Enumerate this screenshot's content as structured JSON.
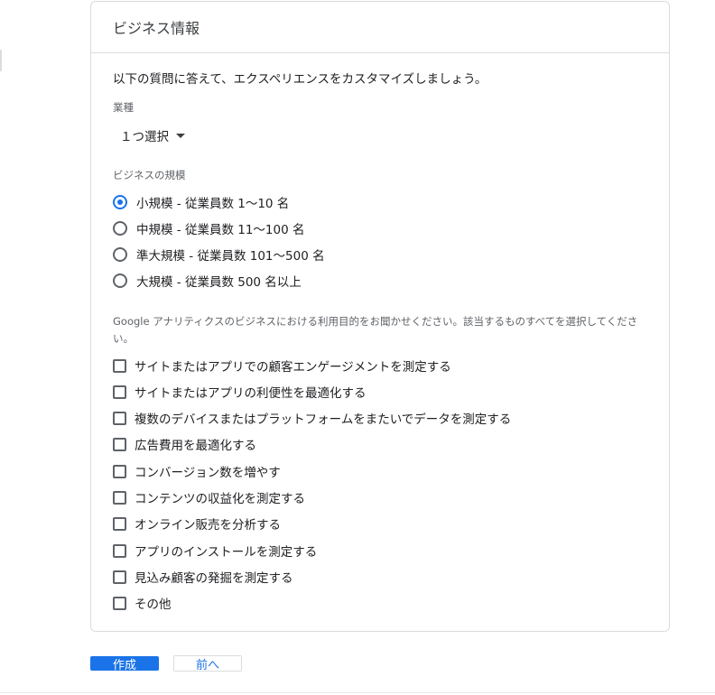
{
  "card": {
    "title": "ビジネス情報",
    "intro": "以下の質問に答えて、エクスペリエンスをカスタマイズしましょう。"
  },
  "industry": {
    "label": "業種",
    "selected": "１つ選択"
  },
  "business_size": {
    "label": "ビジネスの規模",
    "options": [
      {
        "label": "小規模 - 従業員数 1〜10 名",
        "checked": true
      },
      {
        "label": "中規模 - 従業員数 11〜100 名",
        "checked": false
      },
      {
        "label": "準大規模 - 従業員数 101〜500 名",
        "checked": false
      },
      {
        "label": "大規模 - 従業員数 500 名以上",
        "checked": false
      }
    ]
  },
  "usage": {
    "question": "Google アナリティクスのビジネスにおける利用目的をお聞かせください。該当するものすべてを選択してください。",
    "options": [
      {
        "label": "サイトまたはアプリでの顧客エンゲージメントを測定する",
        "checked": false
      },
      {
        "label": "サイトまたはアプリの利便性を最適化する",
        "checked": false
      },
      {
        "label": "複数のデバイスまたはプラットフォームをまたいでデータを測定する",
        "checked": false
      },
      {
        "label": "広告費用を最適化する",
        "checked": false
      },
      {
        "label": "コンバージョン数を増やす",
        "checked": false
      },
      {
        "label": "コンテンツの収益化を測定する",
        "checked": false
      },
      {
        "label": "オンライン販売を分析する",
        "checked": false
      },
      {
        "label": "アプリのインストールを測定する",
        "checked": false
      },
      {
        "label": "見込み顧客の発掘を測定する",
        "checked": false
      },
      {
        "label": "その他",
        "checked": false
      }
    ]
  },
  "actions": {
    "create_label": "作成",
    "back_label": "前へ"
  },
  "colors": {
    "accent": "#1a73e8",
    "border": "#dadce0"
  }
}
